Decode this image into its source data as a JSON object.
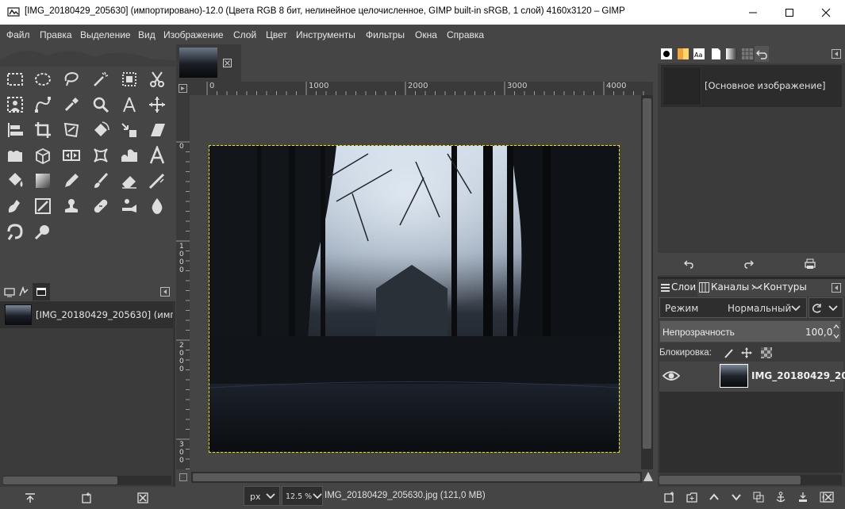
{
  "window": {
    "title": "[IMG_20180429_205630] (импортировано)-12.0 (Цвета RGB 8 бит, нелинейное целочисленное, GIMP built-in sRGB, 1 слой) 4160x3120 – GIMP"
  },
  "menu": [
    "Файл",
    "Правка",
    "Выделение",
    "Вид",
    "Изображение",
    "Слой",
    "Цвет",
    "Инструменты",
    "Фильтры",
    "Окна",
    "Справка"
  ],
  "colors": {
    "foreground": "#a09d92",
    "background": "#000000"
  },
  "images_panel": {
    "item_label": "[IMG_20180429_205630] (имп"
  },
  "canvas": {
    "ruler_h": [
      "0",
      "1000",
      "2000",
      "3000",
      "4000"
    ],
    "ruler_v_digits": [
      [
        "0"
      ],
      [
        "1",
        "0",
        "0",
        "0"
      ],
      [
        "2",
        "0",
        "0",
        "0"
      ],
      [
        "3",
        "0",
        "0"
      ]
    ],
    "status": {
      "unit": "px",
      "zoom": "12.5 %",
      "file_info": "IMG_20180429_205630.jpg (121,0 MB)"
    }
  },
  "brushes_panel": {
    "item_label": "[Основное изображение]"
  },
  "layers_panel": {
    "tabs": [
      "Слои",
      "Каналы",
      "Контуры"
    ],
    "mode_label": "Режим",
    "mode_value": "Нормальный",
    "opacity_label": "Непрозрачность",
    "opacity_value": "100,0",
    "lock_label": "Блокировка:",
    "layer_name": "IMG_20180429_20"
  }
}
